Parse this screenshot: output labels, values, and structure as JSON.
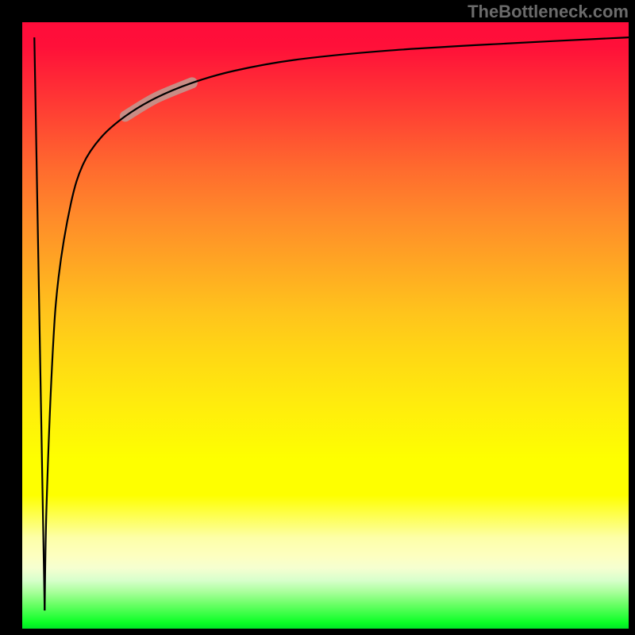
{
  "watermark_text": "TheBottleneck.com",
  "chart_data": {
    "type": "line",
    "title": "",
    "xlabel": "",
    "ylabel": "",
    "xlim": [
      0,
      100
    ],
    "ylim": [
      0,
      100
    ],
    "grid": false,
    "legend": false,
    "background_gradient": {
      "orientation": "vertical",
      "stops": [
        {
          "pos": 0.0,
          "color": "#ff0c3a"
        },
        {
          "pos": 0.12,
          "color": "#ff3335"
        },
        {
          "pos": 0.24,
          "color": "#ff6a2e"
        },
        {
          "pos": 0.4,
          "color": "#ffa723"
        },
        {
          "pos": 0.55,
          "color": "#ffd814"
        },
        {
          "pos": 0.72,
          "color": "#feff00"
        },
        {
          "pos": 0.88,
          "color": "#fdffc0"
        },
        {
          "pos": 0.94,
          "color": "#a8ff9a"
        },
        {
          "pos": 1.0,
          "color": "#00e626"
        }
      ]
    },
    "series": [
      {
        "name": "rising-curve",
        "color": "#000000",
        "x": [
          3.7,
          4.0,
          5.0,
          6.0,
          8.0,
          10.0,
          13.0,
          17.0,
          22.0,
          28.0,
          35.0,
          45.0,
          60.0,
          80.0,
          100.0
        ],
        "y": [
          3.0,
          20.0,
          45.0,
          58.0,
          70.0,
          76.5,
          81.0,
          84.5,
          87.5,
          90.0,
          92.0,
          93.8,
          95.3,
          96.5,
          97.5
        ]
      },
      {
        "name": "falling-line",
        "color": "#000000",
        "x": [
          2.0,
          3.7
        ],
        "y": [
          97.5,
          3.0
        ]
      }
    ],
    "highlight_segment": {
      "series": "rising-curve",
      "x_range": [
        17.0,
        28.0
      ],
      "color": "#c88c85",
      "stroke_width_px": 14
    }
  }
}
